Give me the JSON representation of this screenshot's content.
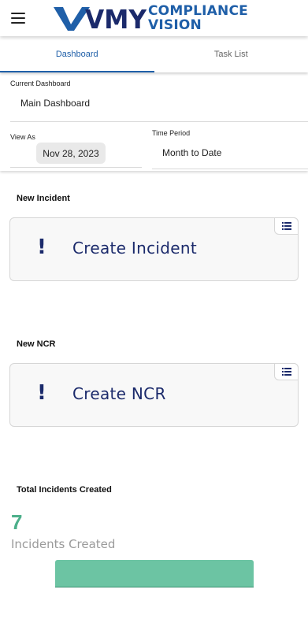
{
  "header": {
    "menu_icon": "hamburger-menu-icon",
    "logo": {
      "mark": "VMY",
      "line1": "COMPLIANCE",
      "line2": "VISION"
    }
  },
  "tabs": [
    {
      "label": "Dashboard",
      "active": true
    },
    {
      "label": "Task List",
      "active": false
    }
  ],
  "filters": {
    "current_dashboard_label": "Current Dashboard",
    "current_dashboard_value": "Main Dashboard",
    "view_as_label": "View As",
    "view_as_value": "Nov 28, 2023",
    "time_period_label": "Time Period",
    "time_period_value": "Month to Date"
  },
  "sections": {
    "incident": {
      "title": "New Incident",
      "card_label": "Create Incident",
      "icon": "exclamation-icon",
      "menu_icon": "list-icon"
    },
    "ncr": {
      "title": "New NCR",
      "card_label": "Create NCR",
      "icon": "exclamation-icon",
      "menu_icon": "list-icon"
    },
    "total": {
      "title": "Total Incidents Created",
      "count": "7",
      "count_label": "Incidents Created",
      "bar_fraction": 1.0
    }
  },
  "colors": {
    "brand_blue": "#1f5fa8",
    "navy": "#1b2a6b",
    "accent_green": "#4caf8a",
    "bar_green": "#6cc4a3"
  }
}
